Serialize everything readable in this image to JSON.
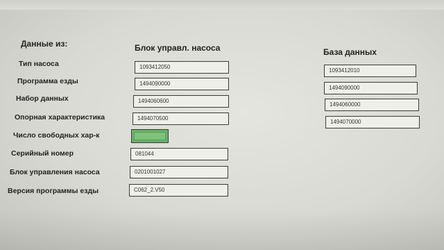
{
  "headers": {
    "data_from": "Данные из:",
    "control_unit": "Блок управл. насоса",
    "database": "База данных"
  },
  "rows": [
    {
      "label": "Тип насоса",
      "value": "1093412050"
    },
    {
      "label": "Программа езды",
      "value": "1494090000"
    },
    {
      "label": "Набор данных",
      "value": "1494060600"
    },
    {
      "label": "Опорная характеристика",
      "value": "1494070500"
    },
    {
      "label": "Число свободных хар-к",
      "value": ""
    },
    {
      "label": "Серийный номер",
      "value": "081044"
    },
    {
      "label": "Блок управления насоса",
      "value": "0201001027"
    },
    {
      "label": "Версия программы езды",
      "value": "C062_2.V50"
    }
  ],
  "database_values": [
    "1093412010",
    "1494090000",
    "1494060000",
    "1494070000"
  ],
  "colors": {
    "free_characteristics_indicator": "#6bb06b"
  }
}
